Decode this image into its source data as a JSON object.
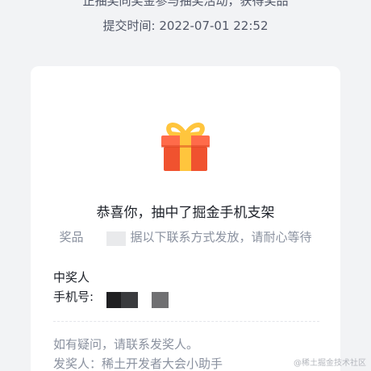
{
  "header": {
    "top_cut_text": "正抽奖同奖金参与抽奖活动，获得奖品",
    "submit_time": "提交时间: 2022-07-01 22:52"
  },
  "card": {
    "icon": "gift-icon",
    "title": "恭喜你，抽中了掘金手机支架",
    "subtitle_left": "奖品",
    "subtitle_right": "据以下联系方式发放，请耐心等待",
    "winner_label": "中奖人",
    "phone_label": "手机号:",
    "note_line1": "如有疑问，请联系发奖人。",
    "note_line2": "发奖人：稀土开发者大会小助手"
  },
  "watermark": "@稀土掘金技术社区",
  "colors": {
    "gift_box": "#f0522f",
    "gift_lid": "#ff6b4a",
    "gift_ribbon": "#ffc53d",
    "background": "#f2f3f5",
    "card": "#ffffff"
  }
}
